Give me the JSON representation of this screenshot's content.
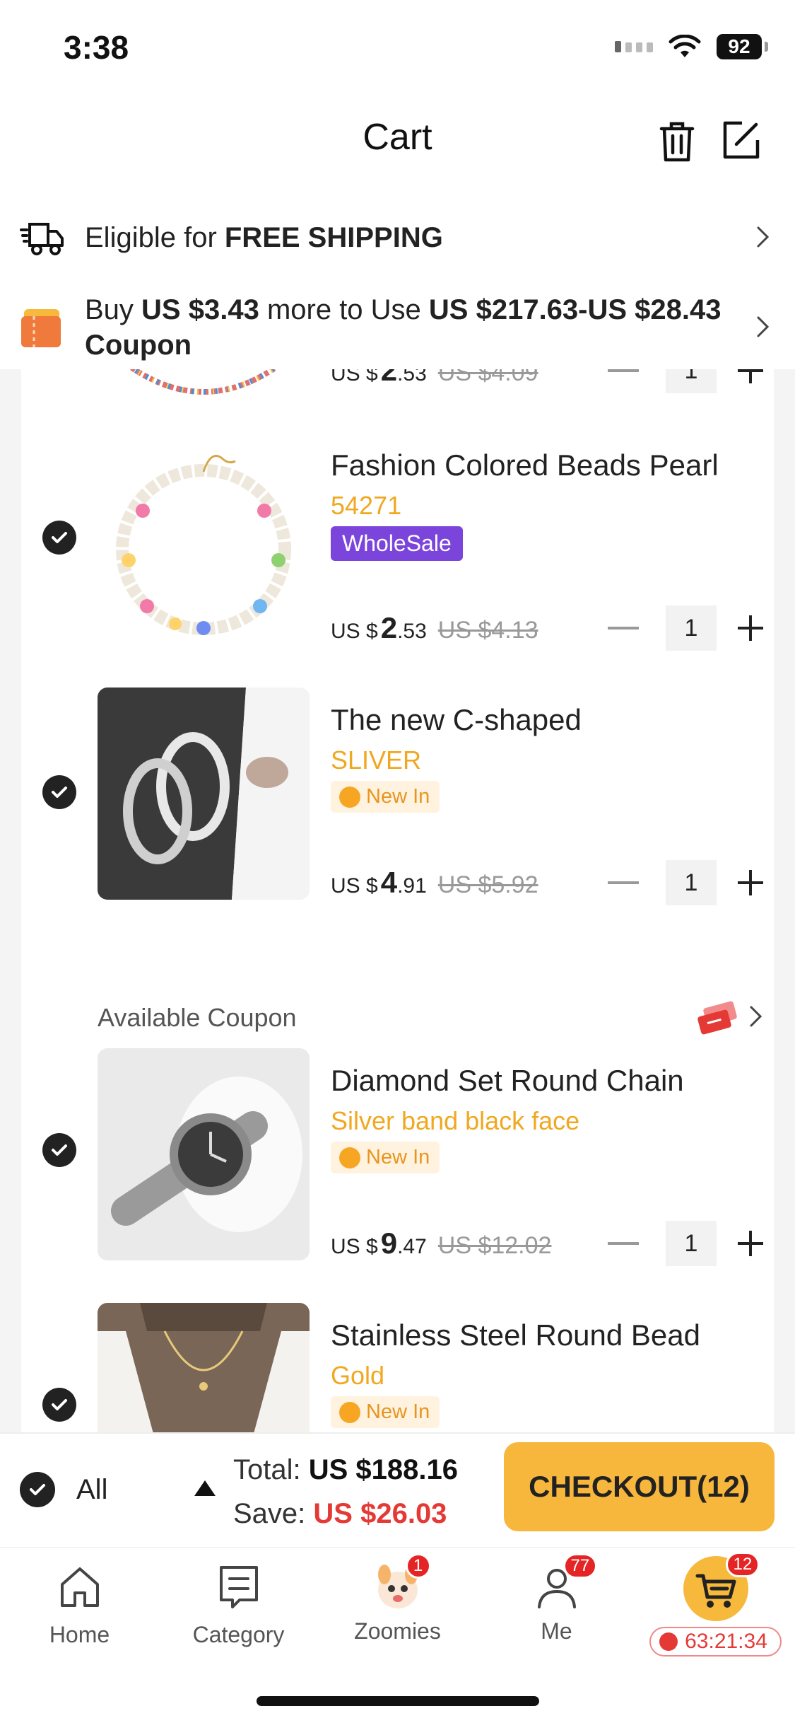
{
  "status_bar": {
    "time": "3:38",
    "battery": "92"
  },
  "header": {
    "title": "Cart",
    "trash_icon": "trash-icon",
    "edit_icon": "edit-icon"
  },
  "banners": {
    "shipping": {
      "prefix": "Eligible for ",
      "strong": "FREE SHIPPING"
    },
    "coupon": {
      "t1": "Buy ",
      "s1": "US $3.43",
      "t2": " more to Use ",
      "s2": "US $217.63-US $28.43 Coupon"
    }
  },
  "items": [
    {
      "title": "",
      "variant": "",
      "tag": "",
      "currency": "US $",
      "price_int": "2",
      "price_cents": ".53",
      "orig_price": "US $4.09",
      "qty": "1"
    },
    {
      "title": "Fashion Colored Beads Pearl",
      "variant": "54271",
      "tag": "WholeSale",
      "currency": "US $",
      "price_int": "2",
      "price_cents": ".53",
      "orig_price": "US $4.13",
      "qty": "1"
    },
    {
      "title": "The new C-shaped",
      "variant": "SLIVER",
      "tag": "New In",
      "currency": "US $",
      "price_int": "4",
      "price_cents": ".91",
      "orig_price": "US $5.92",
      "qty": "1"
    },
    {
      "title": "Diamond Set Round Chain",
      "variant": "Silver band black face",
      "tag": "New In",
      "currency": "US $",
      "price_int": "9",
      "price_cents": ".47",
      "orig_price": "US $12.02",
      "qty": "1"
    },
    {
      "title": "Stainless Steel Round Bead",
      "variant": "Gold",
      "tag": "New In"
    }
  ],
  "coupon_row": {
    "label": "Available Coupon"
  },
  "checkout": {
    "all_label": "All",
    "total_label": "Total: ",
    "total_value": "US $188.16",
    "save_label": "Save: ",
    "save_value": "US $26.03",
    "button": "CHECKOUT(12)"
  },
  "tabs": [
    {
      "label": "Home",
      "icon": "home-icon"
    },
    {
      "label": "Category",
      "icon": "category-icon"
    },
    {
      "label": "Zoomies",
      "icon": "zoomies-icon",
      "badge": "1"
    },
    {
      "label": "Me",
      "icon": "person-icon",
      "badge": "77"
    },
    {
      "label": "",
      "icon": "cart-icon",
      "badge": "12",
      "timer": "63:21:34"
    }
  ],
  "colors": {
    "accent": "#f6b73c",
    "variant": "#f0a820",
    "sale": "#e53935",
    "wholesale": "#7b45dc"
  }
}
